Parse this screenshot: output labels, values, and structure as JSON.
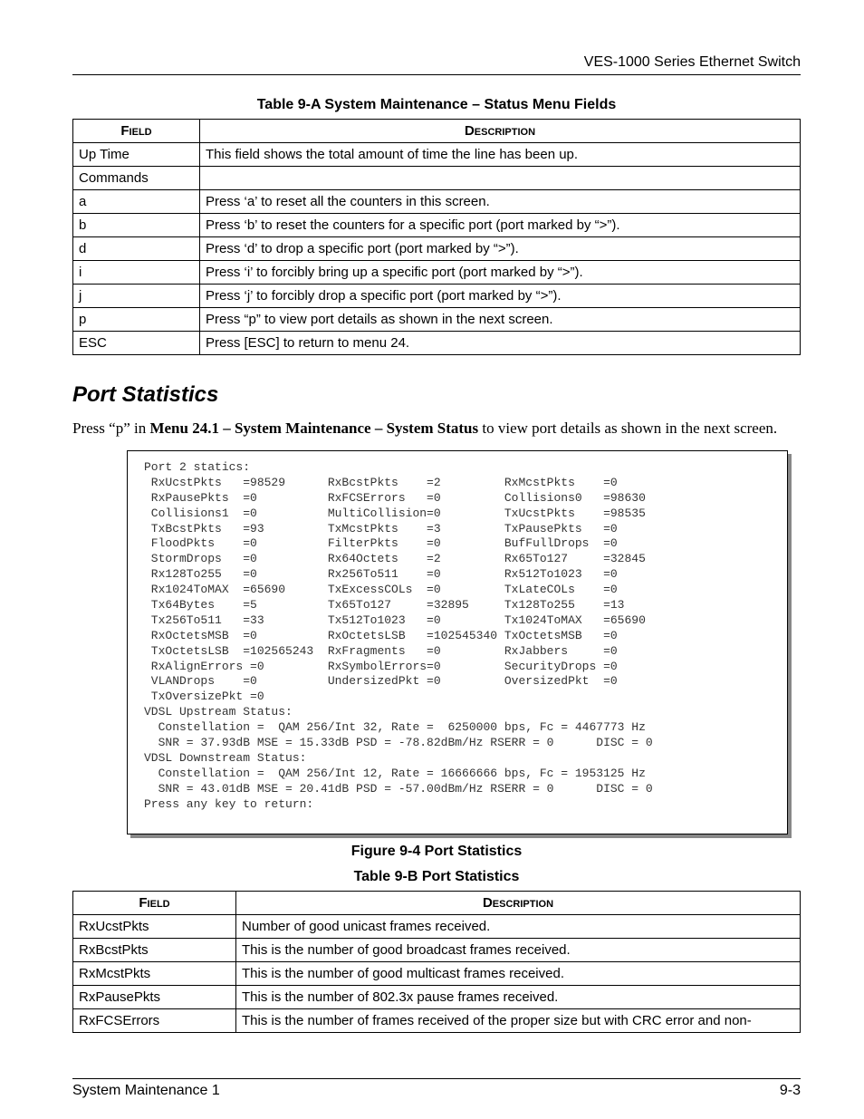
{
  "header": {
    "product": "VES-1000 Series Ethernet Switch"
  },
  "tableA": {
    "caption_prefix": "Table 9-A System Maintenance ",
    "caption_dash": "– ",
    "caption_suffix": "Status Menu Fields",
    "head_field": "Field",
    "head_desc": "Description",
    "rows": [
      {
        "f": "Up Time",
        "d": "This field shows the total amount of time the line has been up."
      },
      {
        "f": "Commands",
        "d": ""
      },
      {
        "f": "a",
        "d": "Press ‘a’ to reset all the counters in this screen.",
        "cmd": true
      },
      {
        "f": "b",
        "d": "Press ‘b’ to reset the counters for a specific port (port marked by “>”).",
        "cmd": true
      },
      {
        "f": "d",
        "d": "Press ‘d’ to drop a specific port (port marked by “>”).",
        "cmd": true
      },
      {
        "f": "i",
        "d": "Press ‘i’ to forcibly bring up a specific port (port marked by “>”).",
        "cmd": true
      },
      {
        "f": "j",
        "d": "Press ‘j’ to forcibly drop a specific port (port marked by “>”).",
        "cmd": true
      },
      {
        "f": "p",
        "d": "Press “p” to view port details as shown in the next screen.",
        "cmd": true
      },
      {
        "f": "ESC",
        "d": "Press [ESC] to return to menu 24.",
        "cmd": true
      }
    ]
  },
  "section_title": "Port Statistics",
  "intro": {
    "p1a": "Press “p” in ",
    "p1b": "Menu 24.1 – System Maintenance – System Status",
    "p1c": " to view port details as shown in the next screen."
  },
  "terminal": "Port 2 statics:\n RxUcstPkts   =98529      RxBcstPkts    =2         RxMcstPkts    =0\n RxPausePkts  =0          RxFCSErrors   =0         Collisions0   =98630\n Collisions1  =0          MultiCollision=0         TxUcstPkts    =98535\n TxBcstPkts   =93         TxMcstPkts    =3         TxPausePkts   =0\n FloodPkts    =0          FilterPkts    =0         BufFullDrops  =0\n StormDrops   =0          Rx64Octets    =2         Rx65To127     =32845\n Rx128To255   =0          Rx256To511    =0         Rx512To1023   =0\n Rx1024ToMAX  =65690      TxExcessCOLs  =0         TxLateCOLs    =0\n Tx64Bytes    =5          Tx65To127     =32895     Tx128To255    =13\n Tx256To511   =33         Tx512To1023   =0         Tx1024ToMAX   =65690\n RxOctetsMSB  =0          RxOctetsLSB   =102545340 TxOctetsMSB   =0\n TxOctetsLSB  =102565243  RxFragments   =0         RxJabbers     =0\n RxAlignErrors =0         RxSymbolErrors=0         SecurityDrops =0\n VLANDrops    =0          UndersizedPkt =0         OversizedPkt  =0\n TxOversizePkt =0\nVDSL Upstream Status:\n  Constellation =  QAM 256/Int 32, Rate =  6250000 bps, Fc = 4467773 Hz\n  SNR = 37.93dB MSE = 15.33dB PSD = -78.82dBm/Hz RSERR = 0      DISC = 0\nVDSL Downstream Status:\n  Constellation =  QAM 256/Int 12, Rate = 16666666 bps, Fc = 1953125 Hz\n  SNR = 43.01dB MSE = 20.41dB PSD = -57.00dBm/Hz RSERR = 0      DISC = 0\nPress any key to return:",
  "fig_caption": "Figure 9-4 Port Statistics",
  "tableB": {
    "caption": "Table 9-B Port Statistics",
    "head_field": "Field",
    "head_desc": "Description",
    "rows": [
      {
        "f": "RxUcstPkts",
        "d": "Number of good unicast frames received."
      },
      {
        "f": "RxBcstPkts",
        "d": "This is the number of good broadcast frames received."
      },
      {
        "f": "RxMcstPkts",
        "d": "This is the number of good multicast frames received."
      },
      {
        "f": "RxPausePkts",
        "d": "This is the number of 802.3x pause frames received."
      },
      {
        "f": "RxFCSErrors",
        "d": "This is the number of frames received of the proper size but with CRC error and non-"
      }
    ]
  },
  "footer": {
    "left": "System Maintenance 1",
    "right": "9-3"
  }
}
